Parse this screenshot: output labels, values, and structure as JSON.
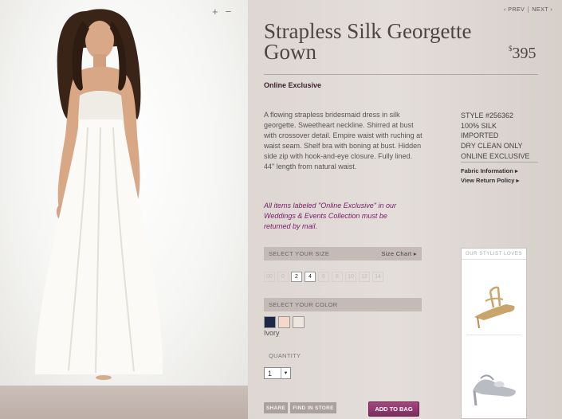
{
  "product": {
    "title": "Strapless Silk Georgette Gown",
    "price_currency": "$",
    "price_amount": "395",
    "online_exclusive": "Online Exclusive",
    "description": "A flowing strapless bridesmaid dress in silk georgette. Sweetheart neckline. Shirred at bust with crossover detail. Empire waist with ruching at waist seam. Shelf bra with boning at bust. Hidden side zip with hook-and-eye closure. Fully lined. 44\" length from natural waist.",
    "specs": [
      "STYLE #256362",
      "100% SILK",
      "IMPORTED",
      "DRY CLEAN ONLY",
      "ONLINE EXCLUSIVE"
    ],
    "links": {
      "fabric": "Fabric Information",
      "returns": "View Return Policy"
    },
    "note": "All items labeled \"Online Exclusive\" in our Weddings & Events Collection must be returned by mail."
  },
  "image_controls": {
    "zoom_in": "+",
    "zoom_out": "−"
  },
  "nav": {
    "prev": "PREV",
    "next": "NEXT"
  },
  "size_selector": {
    "label": "SELECT YOUR SIZE",
    "chart_link": "Size Chart",
    "sizes": [
      {
        "label": "00",
        "available": false
      },
      {
        "label": "0",
        "available": false
      },
      {
        "label": "2",
        "available": true
      },
      {
        "label": "4",
        "available": true
      },
      {
        "label": "6",
        "available": false
      },
      {
        "label": "8",
        "available": false
      },
      {
        "label": "10",
        "available": false
      },
      {
        "label": "12",
        "available": false
      },
      {
        "label": "14",
        "available": false
      }
    ]
  },
  "color_selector": {
    "label": "SELECT YOUR COLOR",
    "swatches": [
      "#1f2748",
      "#f5d8c9",
      "#ece6dc"
    ],
    "selected_name": "Ivory"
  },
  "quantity": {
    "label": "QUANTITY",
    "value": "1"
  },
  "actions": {
    "share": "SHARE",
    "find_in_store": "FIND IN STORE",
    "add_to_bag": "ADD TO BAG"
  },
  "stylist": {
    "heading": "OUR STYLIST LOVES"
  },
  "colors": {
    "accent": "#7b2d5e",
    "note_text": "#7a1a6b",
    "title_text": "#4e4440"
  }
}
